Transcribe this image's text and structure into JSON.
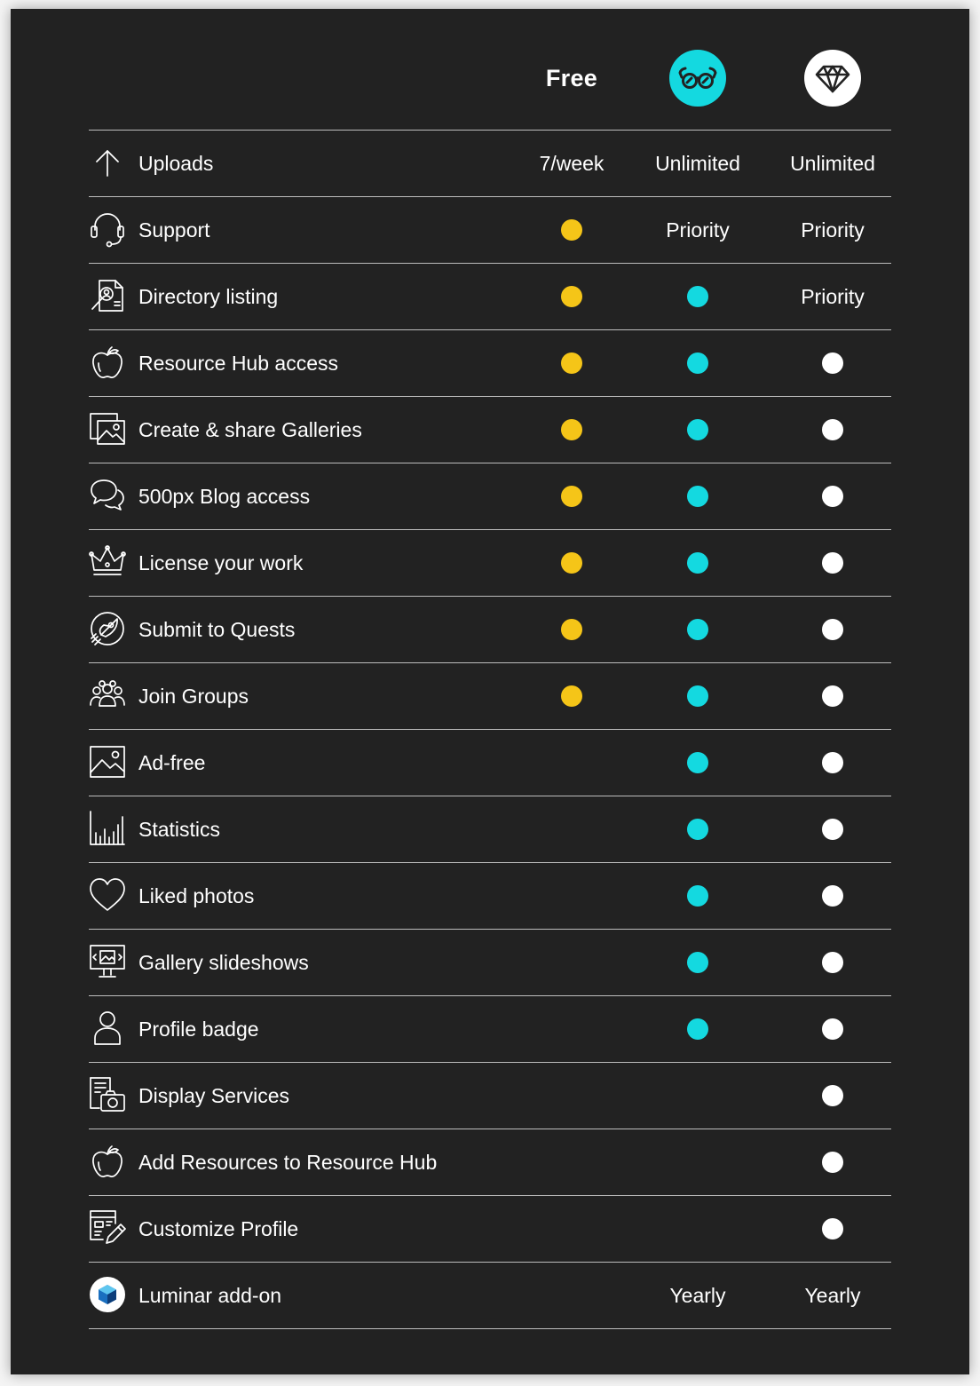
{
  "colors": {
    "free": "#f5c518",
    "awesome": "#14d9e0",
    "pro": "#ffffff"
  },
  "header": {
    "free_label": "Free",
    "awesome_icon": "glasses-icon",
    "pro_icon": "diamond-icon"
  },
  "features": [
    {
      "label": "Uploads",
      "icon": "upload-arrow-icon",
      "free": "7/week",
      "awesome": "Unlimited",
      "pro": "Unlimited"
    },
    {
      "label": "Support",
      "icon": "headset-icon",
      "free": "dot",
      "awesome": "Priority",
      "pro": "Priority"
    },
    {
      "label": "Directory listing",
      "icon": "directory-search-icon",
      "free": "dot",
      "awesome": "dot",
      "pro": "Priority"
    },
    {
      "label": "Resource Hub access",
      "icon": "apple-icon",
      "free": "dot",
      "awesome": "dot",
      "pro": "dot"
    },
    {
      "label": "Create & share Galleries",
      "icon": "gallery-icon",
      "free": "dot",
      "awesome": "dot",
      "pro": "dot"
    },
    {
      "label": "500px Blog access",
      "icon": "chat-bubbles-icon",
      "free": "dot",
      "awesome": "dot",
      "pro": "dot"
    },
    {
      "label": "License your work",
      "icon": "crown-icon",
      "free": "dot",
      "awesome": "dot",
      "pro": "dot"
    },
    {
      "label": "Submit to Quests",
      "icon": "rocket-icon",
      "free": "dot",
      "awesome": "dot",
      "pro": "dot"
    },
    {
      "label": "Join Groups",
      "icon": "group-icon",
      "free": "dot",
      "awesome": "dot",
      "pro": "dot"
    },
    {
      "label": "Ad-free",
      "icon": "image-icon",
      "free": "",
      "awesome": "dot",
      "pro": "dot"
    },
    {
      "label": "Statistics",
      "icon": "bar-chart-icon",
      "free": "",
      "awesome": "dot",
      "pro": "dot"
    },
    {
      "label": "Liked photos",
      "icon": "heart-icon",
      "free": "",
      "awesome": "dot",
      "pro": "dot"
    },
    {
      "label": "Gallery slideshows",
      "icon": "slideshow-monitor-icon",
      "free": "",
      "awesome": "dot",
      "pro": "dot"
    },
    {
      "label": "Profile badge",
      "icon": "user-icon",
      "free": "",
      "awesome": "dot",
      "pro": "dot"
    },
    {
      "label": "Display Services",
      "icon": "camera-document-icon",
      "free": "",
      "awesome": "",
      "pro": "dot"
    },
    {
      "label": "Add Resources to Resource Hub",
      "icon": "apple-icon",
      "free": "",
      "awesome": "",
      "pro": "dot"
    },
    {
      "label": "Customize Profile",
      "icon": "edit-layout-icon",
      "free": "",
      "awesome": "",
      "pro": "dot"
    },
    {
      "label": "Luminar add-on",
      "icon": "luminar-logo-icon",
      "free": "",
      "awesome": "Yearly",
      "pro": "Yearly"
    }
  ]
}
